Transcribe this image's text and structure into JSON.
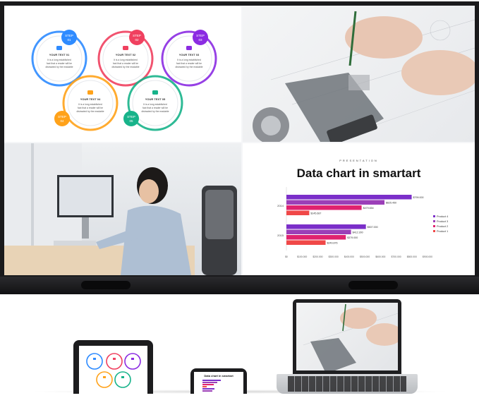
{
  "infographic": {
    "steps": [
      {
        "label": "STEP 01",
        "title": "YOUR TEXT 01",
        "body": "It is a long established fact that a reader will be distracted by the readable",
        "color": "#2e8bff"
      },
      {
        "label": "STEP 02",
        "title": "YOUR TEXT 02",
        "body": "It is a long established fact that a reader will be distracted by the readable",
        "color": "#f0405f"
      },
      {
        "label": "STEP 03",
        "title": "YOUR TEXT 03",
        "body": "It is a long established fact that a reader will be distracted by the readable",
        "color": "#8b2be2"
      },
      {
        "label": "STEP 04",
        "title": "YOUR TEXT 04",
        "body": "It is a long established fact that a reader will be distracted by the readable",
        "color": "#ffa21a"
      },
      {
        "label": "STEP 05",
        "title": "YOUR TEXT 05",
        "body": "It is a long established fact that a reader will be distracted by the readable",
        "color": "#17b38a"
      }
    ]
  },
  "presentation": {
    "kicker": "PRESENTATION",
    "title": "Data chart in smartart",
    "phone_title": "Data chart in smartart"
  },
  "chart_data": {
    "type": "bar",
    "orientation": "horizontal",
    "categories": [
      "2014",
      "2015"
    ],
    "series": [
      {
        "name": "Product 4",
        "color": "#7b2fc9",
        "values": [
          799000,
          507000
        ]
      },
      {
        "name": "Product 3",
        "color": "#9b3fb8",
        "values": [
          625450,
          412300
        ]
      },
      {
        "name": "Product 2",
        "color": "#e0226f",
        "values": [
          479654,
          379000
        ]
      },
      {
        "name": "Product 1",
        "color": "#f04848",
        "values": [
          145687,
          249876
        ]
      }
    ],
    "value_labels": [
      [
        "$799.000",
        "$625.450",
        "$479.654",
        "$145.687"
      ],
      [
        "$507.000",
        "$412.300",
        "$379.000",
        "$249.876"
      ]
    ],
    "x_ticks": [
      "$0",
      "$100.000",
      "$200.000",
      "$300.000",
      "$400.000",
      "$500.000",
      "$600.000",
      "$700.000",
      "$800.000",
      "$900.000"
    ],
    "xlim": [
      0,
      900000
    ],
    "legend": "right"
  }
}
